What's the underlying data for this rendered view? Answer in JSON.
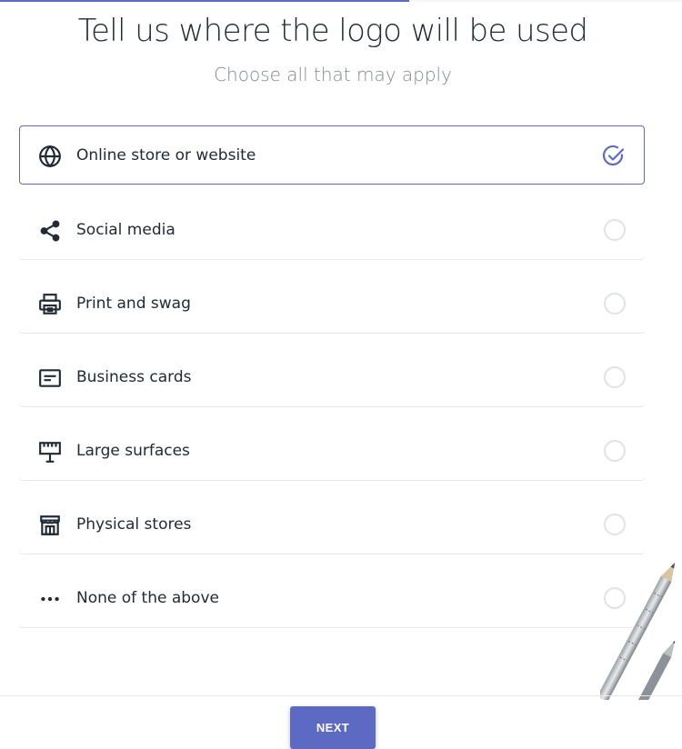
{
  "progress": {
    "fraction": 0.6
  },
  "header": {
    "title": "Tell us where the logo will be used",
    "subtitle": "Choose all that may apply"
  },
  "options": [
    {
      "label": "Online store or website",
      "icon": "globe-icon",
      "selected": true
    },
    {
      "label": "Social media",
      "icon": "share-icon",
      "selected": false
    },
    {
      "label": "Print and swag",
      "icon": "printer-icon",
      "selected": false
    },
    {
      "label": "Business cards",
      "icon": "business-card-icon",
      "selected": false
    },
    {
      "label": "Large surfaces",
      "icon": "billboard-icon",
      "selected": false
    },
    {
      "label": "Physical stores",
      "icon": "storefront-icon",
      "selected": false
    },
    {
      "label": "None of the above",
      "icon": "more-dots-icon",
      "selected": false
    }
  ],
  "footer": {
    "next_label": "NEXT"
  },
  "colors": {
    "accent": "#5c6ac4",
    "text": "#212b36",
    "subtitle": "#828a91",
    "radio_border": "#dfe3e8"
  }
}
